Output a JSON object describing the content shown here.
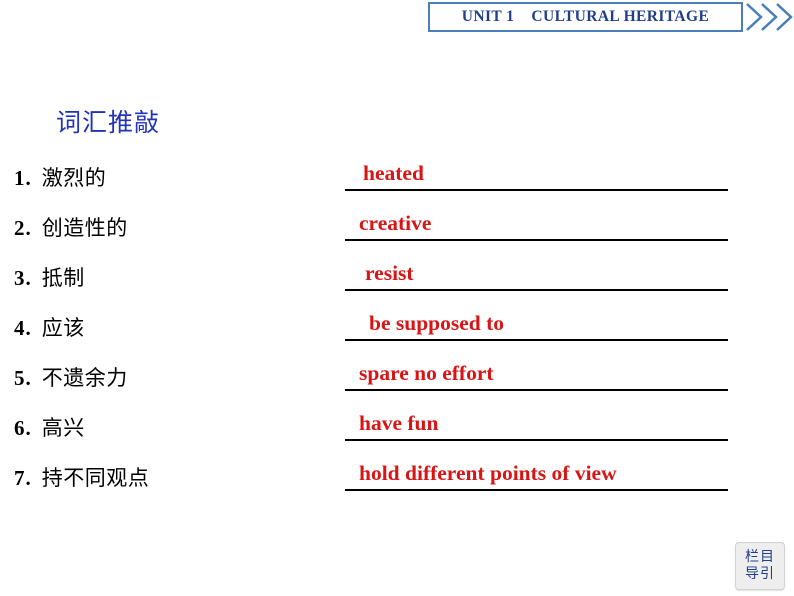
{
  "header": {
    "unit_label": "UNIT 1    CULTURAL HERITAGE",
    "banner_border_color": "#4a7ebb",
    "title_color": "#1f3e8c",
    "chevron_icon": "double-chevron-right-icon"
  },
  "section": {
    "title": "词汇推敲",
    "title_color": "#2233bb"
  },
  "vocabulary": {
    "answer_color": "#d81414",
    "items": [
      {
        "number": "1",
        "separator": ".",
        "chinese": "激烈的",
        "answer": "heated"
      },
      {
        "number": "2",
        "separator": ".",
        "chinese": "创造性的",
        "answer": "creative"
      },
      {
        "number": "3",
        "separator": ".",
        "chinese": "抵制",
        "answer": "resist"
      },
      {
        "number": "4",
        "separator": ".",
        "chinese": "应该",
        "answer": "be supposed to"
      },
      {
        "number": "5",
        "separator": ".",
        "chinese": "不遗余力",
        "answer": "spare no effort"
      },
      {
        "number": "6",
        "separator": ".",
        "chinese": "高兴",
        "answer": "have fun"
      },
      {
        "number": "7",
        "separator": ".",
        "chinese": "持不同观点",
        "answer": "hold different points of view"
      }
    ]
  },
  "nav_badge": {
    "line1": "栏目",
    "line2": "导引",
    "text_color": "#1f3e8c"
  }
}
